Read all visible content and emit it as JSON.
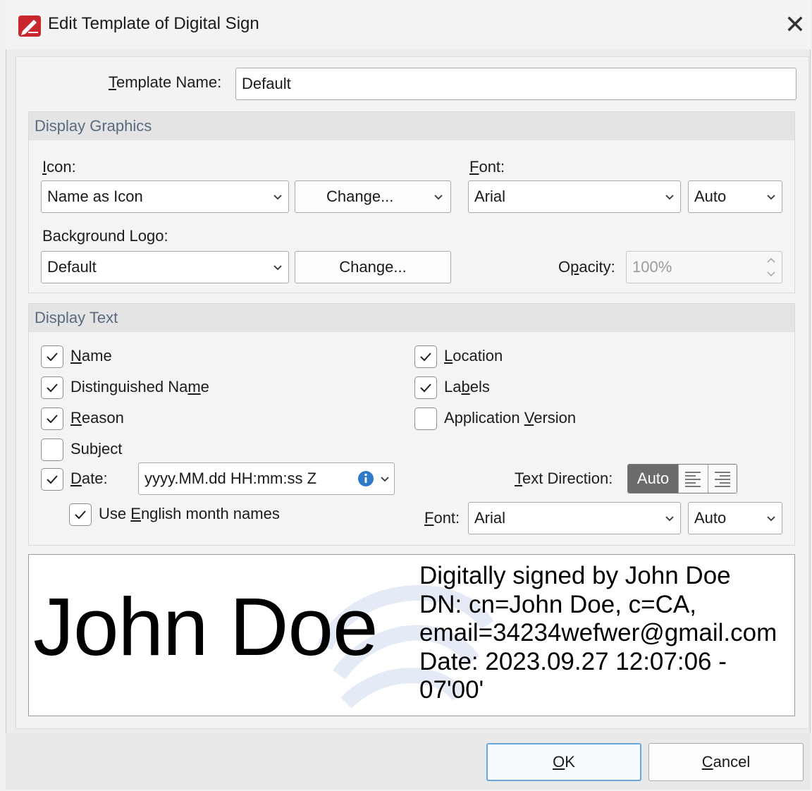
{
  "window": {
    "title": "Edit Template of Digital Sign",
    "close_glyph": "✕",
    "icon": "foxit-pen-icon"
  },
  "template_name": {
    "label_prefix": "",
    "label_key": "T",
    "label_rest": "emplate Name:",
    "value": "Default"
  },
  "display_graphics": {
    "heading": "Display Graphics",
    "icon_label_key": "I",
    "icon_label_rest": "con:",
    "icon_select": "Name as Icon",
    "icon_change": "Change...",
    "font_label_key": "F",
    "font_label_rest": "ont:",
    "font_select": "Arial",
    "font_size_select": "Auto",
    "logo_label_pre": "Back",
    "logo_label_key": "g",
    "logo_label_rest": "round Logo:",
    "logo_select": "Default",
    "logo_change": "Change...",
    "opacity_label_pre": "O",
    "opacity_label_key": "p",
    "opacity_label_rest": "acity:",
    "opacity_value": "100%"
  },
  "display_text": {
    "heading": "Display Text",
    "checkboxes": {
      "name": {
        "pre": "",
        "key": "N",
        "rest": "ame",
        "checked": true
      },
      "distinguished_name": {
        "pre": "Distinguished Na",
        "key": "m",
        "rest": "e",
        "checked": true
      },
      "reason": {
        "pre": "",
        "key": "R",
        "rest": "eason",
        "checked": true
      },
      "subject": {
        "pre": "Subject",
        "key": "",
        "rest": "",
        "checked": false
      },
      "date": {
        "pre": "",
        "key": "D",
        "rest": "ate:",
        "checked": true
      },
      "english_months": {
        "pre": "Use ",
        "key": "E",
        "rest": "nglish month names",
        "checked": true
      },
      "location": {
        "pre": "",
        "key": "L",
        "rest": "ocation",
        "checked": true
      },
      "labels": {
        "pre": "La",
        "key": "b",
        "rest": "els",
        "checked": true
      },
      "app_version": {
        "pre": "Application ",
        "key": "V",
        "rest": "ersion",
        "checked": false
      }
    },
    "date_format": "yyyy.MM.dd HH:mm:ss Z",
    "text_direction_key": "T",
    "text_direction_rest": "ext Direction:",
    "text_direction_auto": "Auto",
    "font_label_key": "F",
    "font_label_rest": "ont:",
    "font_select": "Arial",
    "font_size_select": "Auto"
  },
  "preview": {
    "name": "John Doe",
    "lines": [
      "Digitally signed by John Doe",
      "DN: cn=John Doe, c=CA,",
      "email=34234wefwer@gmail.com",
      "Date: 2023.09.27 12:07:06 -",
      "07'00'"
    ]
  },
  "footer": {
    "ok_key": "O",
    "ok_rest": "K",
    "cancel_key": "C",
    "cancel_rest": "ancel"
  },
  "colors": {
    "accent": "#2f79c7",
    "check": "#1f1f1f",
    "ok_border": "#6aa6da"
  }
}
